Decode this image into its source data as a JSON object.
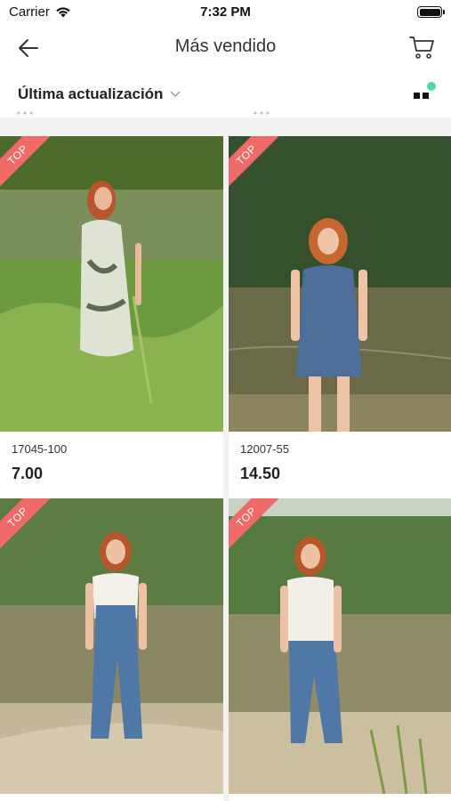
{
  "status_bar": {
    "carrier": "Carrier",
    "time": "7:32 PM"
  },
  "nav": {
    "title": "Más vendido",
    "back_icon": "arrow-left-icon",
    "cart_icon": "cart-icon"
  },
  "filter": {
    "sort_label": "Última actualización",
    "chevron_icon": "chevron-down-icon",
    "view_icon": "grid-view-icon"
  },
  "products": [
    {
      "badge": "TOP",
      "code": "17045-100",
      "price": "7.00"
    },
    {
      "badge": "TOP",
      "code": "12007-55",
      "price": "14.50"
    },
    {
      "badge": "TOP"
    },
    {
      "badge": "TOP"
    }
  ],
  "colors": {
    "accent": "#f06a6a",
    "view_dot": "#4dd9b0"
  }
}
